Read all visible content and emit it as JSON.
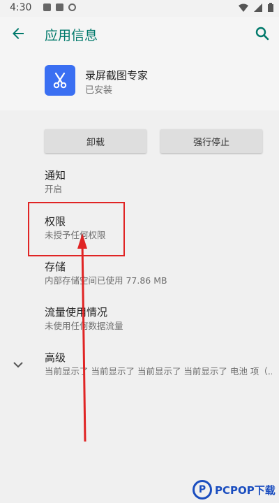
{
  "status_bar": {
    "time": "4:30"
  },
  "app_bar": {
    "title": "应用信息"
  },
  "app": {
    "name": "录屏截图专家",
    "status": "已安装"
  },
  "buttons": {
    "uninstall": "卸载",
    "force_stop": "强行停止"
  },
  "prefs": [
    {
      "title": "通知",
      "summary": "开启"
    },
    {
      "title": "权限",
      "summary": "未授予任何权限"
    },
    {
      "title": "存储",
      "summary": "内部存储空间已使用 77.86 MB"
    },
    {
      "title": "流量使用情况",
      "summary": "未使用任何数据流量"
    },
    {
      "title": "高级",
      "summary": "当前显示了 当前显示了 当前显示了 当前显示了 电池 项（..."
    }
  ],
  "watermark": {
    "text": "PCPOP下载",
    "logo_letter": "P"
  },
  "colors": {
    "accent": "#00796b",
    "app_icon_bg": "#3a6ff2",
    "annotation": "#e02424"
  }
}
